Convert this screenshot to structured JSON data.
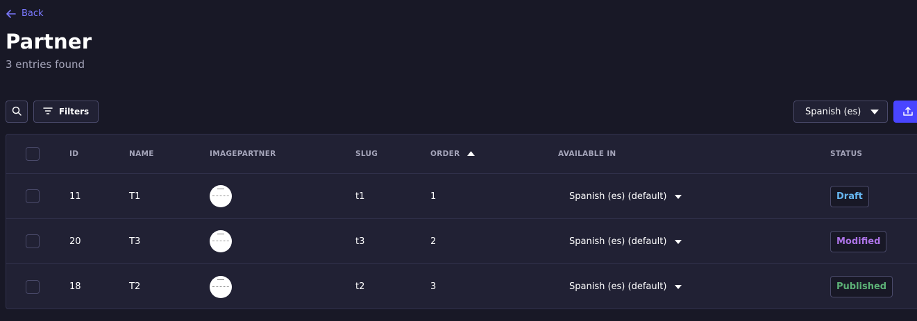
{
  "header": {
    "back_label": "Back",
    "title": "Partner",
    "subtitle": "3 entries found"
  },
  "toolbar": {
    "filters_label": "Filters",
    "locale_selected": "Spanish (es)"
  },
  "table": {
    "columns": {
      "id": "ID",
      "name": "NAME",
      "image": "IMAGEPARTNER",
      "slug": "SLUG",
      "order": "ORDER",
      "available": "AVAILABLE IN",
      "status": "STATUS"
    },
    "rows": [
      {
        "id": "11",
        "name": "T1",
        "slug": "t1",
        "order": "1",
        "available": "Spanish (es) (default)",
        "status": "Draft",
        "status_color": "#66b7f1"
      },
      {
        "id": "20",
        "name": "T3",
        "slug": "t3",
        "order": "2",
        "available": "Spanish (es) (default)",
        "status": "Modified",
        "status_color": "#ac73e6"
      },
      {
        "id": "18",
        "name": "T2",
        "slug": "t2",
        "order": "3",
        "available": "Spanish (es) (default)",
        "status": "Published",
        "status_color": "#5cb176"
      }
    ]
  },
  "colors": {
    "background": "#181826",
    "surface": "#212134",
    "primary": "#4945ff",
    "link": "#7b79ff"
  }
}
